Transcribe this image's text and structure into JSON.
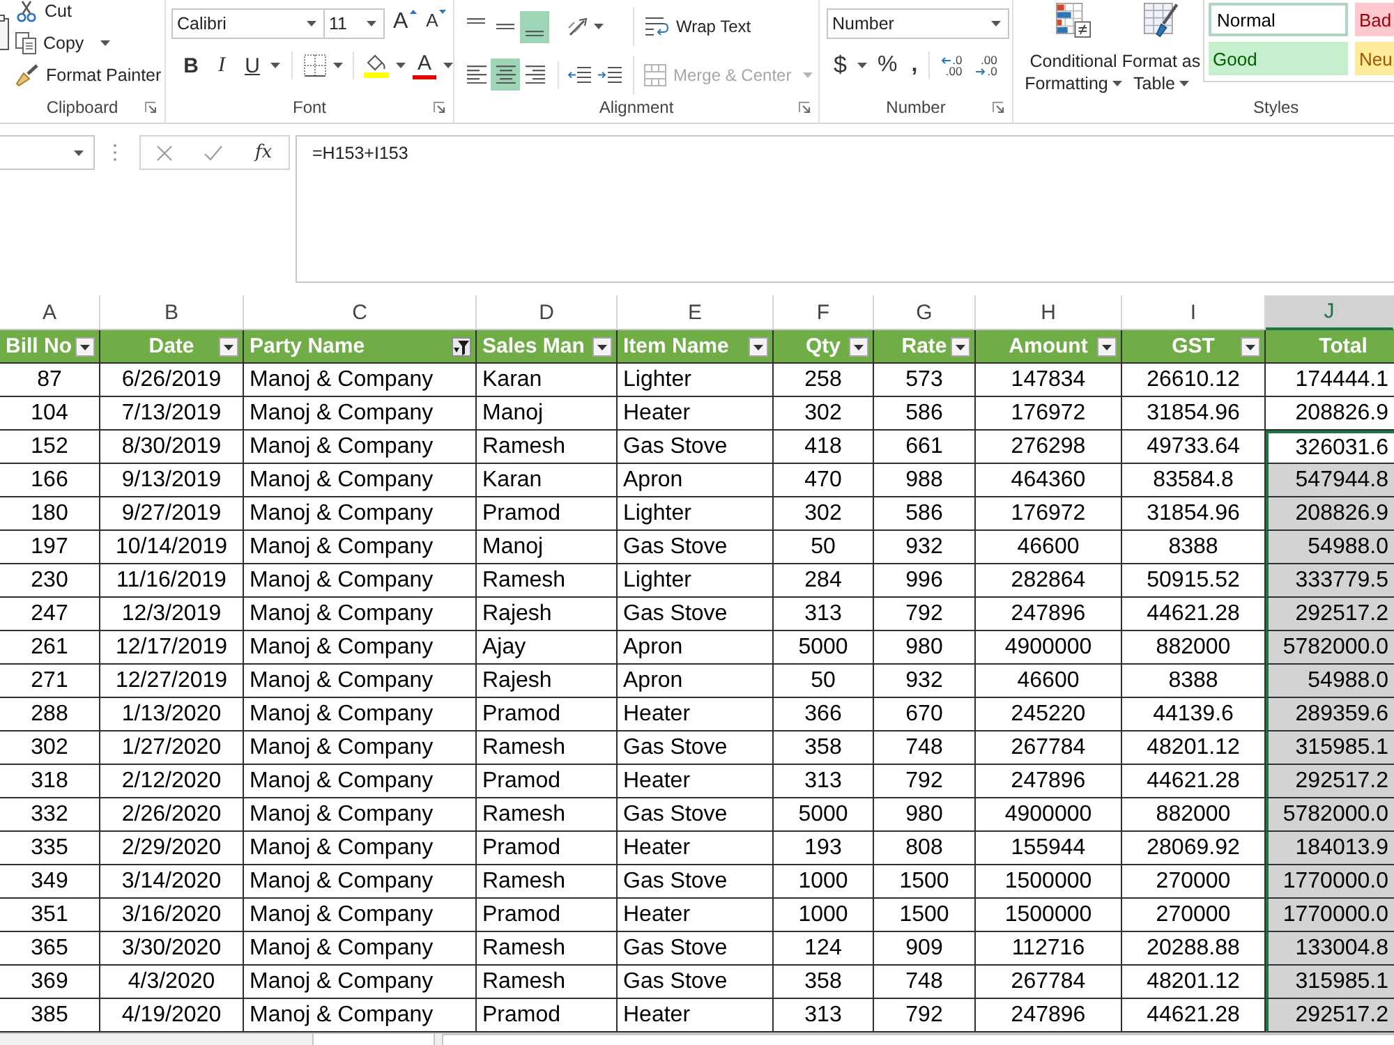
{
  "ribbon": {
    "clipboard": {
      "commands": [
        {
          "label": "Cut"
        },
        {
          "label": "Copy"
        },
        {
          "label": "Format Painter"
        }
      ],
      "label": "Clipboard"
    },
    "font": {
      "font_name": "Calibri",
      "font_size": "11",
      "grow_font": "A",
      "shrink_font": "A",
      "bold": "B",
      "italic": "I",
      "underline": "U",
      "font_color": "A",
      "label": "Font"
    },
    "alignment": {
      "vertical": [
        {
          "selected": false
        },
        {
          "selected": false
        },
        {
          "selected": true
        }
      ],
      "horizontal": [
        {
          "selected": false
        },
        {
          "selected": true
        },
        {
          "selected": false
        }
      ],
      "wrap_text": "Wrap Text",
      "merge": {
        "label": "Merge & Center",
        "disabled": true
      },
      "label": "Alignment"
    },
    "number": {
      "format": "Number",
      "currency": "$",
      "percent": "%",
      "comma": ",",
      "decimals": [
        {
          "kind": "increase",
          "top": ".0",
          "bottom": ".00"
        },
        {
          "kind": "decrease",
          "top": ".00",
          "bottom": ".0"
        }
      ],
      "label": "Number"
    },
    "styles": {
      "commands": [
        {
          "lines": [
            "Conditional",
            "Formatting"
          ]
        },
        {
          "lines": [
            "Format as",
            "Table"
          ]
        }
      ],
      "gallery": [
        {
          "label": "Normal",
          "color": "#ffffff",
          "selected": true
        },
        {
          "label": "Bad",
          "color": "#ffc7ce",
          "selected": false
        },
        {
          "label": "Good",
          "color": "#c6efce",
          "selected": false
        },
        {
          "label": "Neu",
          "color": "#ffeb9c",
          "selected": false
        }
      ],
      "label": "Styles"
    }
  },
  "formula_bar": {
    "function_label": "fx",
    "formula": "=H153+I153"
  },
  "sheet": {
    "column_letters": [
      {
        "letter": "A",
        "selected": false
      },
      {
        "letter": "B",
        "selected": false
      },
      {
        "letter": "C",
        "selected": false
      },
      {
        "letter": "D",
        "selected": false
      },
      {
        "letter": "E",
        "selected": false
      },
      {
        "letter": "F",
        "selected": false
      },
      {
        "letter": "G",
        "selected": false
      },
      {
        "letter": "H",
        "selected": false
      },
      {
        "letter": "I",
        "selected": false
      },
      {
        "letter": "J",
        "selected": true
      }
    ],
    "table": {
      "columns": [
        {
          "heading": "Bill No",
          "filter_button": true,
          "filtered": false
        },
        {
          "heading": "Date",
          "filter_button": true,
          "filtered": false
        },
        {
          "heading": "Party Name",
          "filter_button": true,
          "filtered": true
        },
        {
          "heading": "Sales Man",
          "filter_button": true,
          "filtered": false
        },
        {
          "heading": "Item Name",
          "filter_button": true,
          "filtered": false
        },
        {
          "heading": "Qty",
          "filter_button": true,
          "filtered": false
        },
        {
          "heading": "Rate",
          "filter_button": true,
          "filtered": false
        },
        {
          "heading": "Amount",
          "filter_button": true,
          "filtered": false
        },
        {
          "heading": "GST",
          "filter_button": true,
          "filtered": false
        },
        {
          "heading": "Total"
        }
      ],
      "rows": [
        {
          "cells": [
            "87",
            "6/26/2019",
            "Manoj & Company",
            "Karan",
            "Lighter",
            "258",
            "573",
            "147834",
            "26610.12",
            "174444.1"
          ],
          "total_selected": false,
          "total_active": false
        },
        {
          "cells": [
            "104",
            "7/13/2019",
            "Manoj & Company",
            "Manoj",
            "Heater",
            "302",
            "586",
            "176972",
            "31854.96",
            "208826.9"
          ],
          "total_selected": false,
          "total_active": false
        },
        {
          "cells": [
            "152",
            "8/30/2019",
            "Manoj & Company",
            "Ramesh",
            "Gas Stove",
            "418",
            "661",
            "276298",
            "49733.64",
            "326031.6"
          ],
          "total_selected": true,
          "total_active": true
        },
        {
          "cells": [
            "166",
            "9/13/2019",
            "Manoj & Company",
            "Karan",
            "Apron",
            "470",
            "988",
            "464360",
            "83584.8",
            "547944.8"
          ],
          "total_selected": true,
          "total_active": false
        },
        {
          "cells": [
            "180",
            "9/27/2019",
            "Manoj & Company",
            "Pramod",
            "Lighter",
            "302",
            "586",
            "176972",
            "31854.96",
            "208826.9"
          ],
          "total_selected": true,
          "total_active": false
        },
        {
          "cells": [
            "197",
            "10/14/2019",
            "Manoj & Company",
            "Manoj",
            "Gas Stove",
            "50",
            "932",
            "46600",
            "8388",
            "54988.0"
          ],
          "total_selected": true,
          "total_active": false
        },
        {
          "cells": [
            "230",
            "11/16/2019",
            "Manoj & Company",
            "Ramesh",
            "Lighter",
            "284",
            "996",
            "282864",
            "50915.52",
            "333779.5"
          ],
          "total_selected": true,
          "total_active": false
        },
        {
          "cells": [
            "247",
            "12/3/2019",
            "Manoj & Company",
            "Rajesh",
            "Gas Stove",
            "313",
            "792",
            "247896",
            "44621.28",
            "292517.2"
          ],
          "total_selected": true,
          "total_active": false
        },
        {
          "cells": [
            "261",
            "12/17/2019",
            "Manoj & Company",
            "Ajay",
            "Apron",
            "5000",
            "980",
            "4900000",
            "882000",
            "5782000.0"
          ],
          "total_selected": true,
          "total_active": false
        },
        {
          "cells": [
            "271",
            "12/27/2019",
            "Manoj & Company",
            "Rajesh",
            "Apron",
            "50",
            "932",
            "46600",
            "8388",
            "54988.0"
          ],
          "total_selected": true,
          "total_active": false
        },
        {
          "cells": [
            "288",
            "1/13/2020",
            "Manoj & Company",
            "Pramod",
            "Heater",
            "366",
            "670",
            "245220",
            "44139.6",
            "289359.6"
          ],
          "total_selected": true,
          "total_active": false
        },
        {
          "cells": [
            "302",
            "1/27/2020",
            "Manoj & Company",
            "Ramesh",
            "Gas Stove",
            "358",
            "748",
            "267784",
            "48201.12",
            "315985.1"
          ],
          "total_selected": true,
          "total_active": false
        },
        {
          "cells": [
            "318",
            "2/12/2020",
            "Manoj & Company",
            "Pramod",
            "Heater",
            "313",
            "792",
            "247896",
            "44621.28",
            "292517.2"
          ],
          "total_selected": true,
          "total_active": false
        },
        {
          "cells": [
            "332",
            "2/26/2020",
            "Manoj & Company",
            "Ramesh",
            "Gas Stove",
            "5000",
            "980",
            "4900000",
            "882000",
            "5782000.0"
          ],
          "total_selected": true,
          "total_active": false
        },
        {
          "cells": [
            "335",
            "2/29/2020",
            "Manoj & Company",
            "Pramod",
            "Heater",
            "193",
            "808",
            "155944",
            "28069.92",
            "184013.9"
          ],
          "total_selected": true,
          "total_active": false
        },
        {
          "cells": [
            "349",
            "3/14/2020",
            "Manoj & Company",
            "Ramesh",
            "Gas Stove",
            "1000",
            "1500",
            "1500000",
            "270000",
            "1770000.0"
          ],
          "total_selected": true,
          "total_active": false
        },
        {
          "cells": [
            "351",
            "3/16/2020",
            "Manoj & Company",
            "Pramod",
            "Heater",
            "1000",
            "1500",
            "1500000",
            "270000",
            "1770000.0"
          ],
          "total_selected": true,
          "total_active": false
        },
        {
          "cells": [
            "365",
            "3/30/2020",
            "Manoj & Company",
            "Ramesh",
            "Gas Stove",
            "124",
            "909",
            "112716",
            "20288.88",
            "133004.8"
          ],
          "total_selected": true,
          "total_active": false
        },
        {
          "cells": [
            "369",
            "4/3/2020",
            "Manoj & Company",
            "Ramesh",
            "Gas Stove",
            "358",
            "748",
            "267784",
            "48201.12",
            "315985.1"
          ],
          "total_selected": true,
          "total_active": false
        },
        {
          "cells": [
            "385",
            "4/19/2020",
            "Manoj & Company",
            "Pramod",
            "Heater",
            "313",
            "792",
            "247896",
            "44621.28",
            "292517.2"
          ],
          "total_selected": true,
          "total_active": false
        }
      ]
    }
  }
}
